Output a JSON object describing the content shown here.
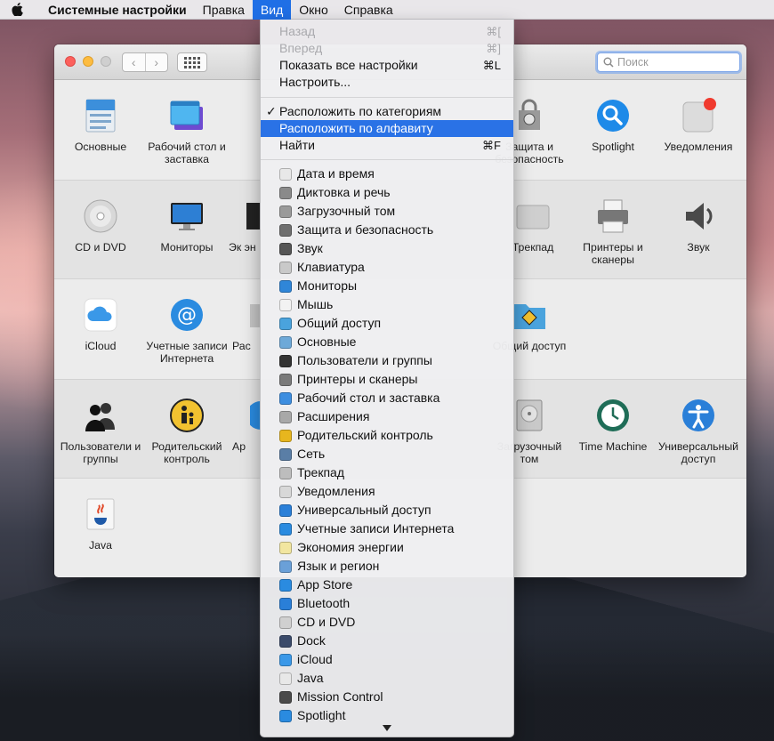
{
  "menubar": {
    "app": "Системные настройки",
    "items": [
      "Правка",
      "Вид",
      "Окно",
      "Справка"
    ]
  },
  "window": {
    "nav_back": "‹",
    "nav_forward": "›",
    "search_placeholder": "Поиск",
    "rows": [
      [
        {
          "label": "Основные",
          "icon": "general-icon"
        },
        {
          "label": "Рабочий стол и заставка",
          "icon": "desktop-icon"
        },
        {
          "label": "Защита и безопасность",
          "icon": "security-icon"
        },
        {
          "label": "Spotlight",
          "icon": "spotlight-icon"
        },
        {
          "label": "Уведомления",
          "icon": "notifications-icon"
        }
      ],
      [
        {
          "label": "CD и DVD",
          "icon": "cd-dvd-icon"
        },
        {
          "label": "Мониторы",
          "icon": "monitor-icon"
        },
        {
          "label": "Эк эн",
          "icon": "energy-icon"
        },
        {
          "label": "Трекпад",
          "icon": "trackpad-icon"
        },
        {
          "label": "Принтеры и сканеры",
          "icon": "printer-icon"
        },
        {
          "label": "Звук",
          "icon": "sound-icon"
        }
      ],
      [
        {
          "label": "iCloud",
          "icon": "icloud-icon"
        },
        {
          "label": "Учетные записи Интернета",
          "icon": "internet-accounts-icon"
        },
        {
          "label": "Рас",
          "icon": "extensions-icon"
        },
        {
          "label": "Общий доступ",
          "icon": "sharing-icon"
        }
      ],
      [
        {
          "label": "Пользователи и группы",
          "icon": "users-icon"
        },
        {
          "label": "Родительский контроль",
          "icon": "parental-icon"
        },
        {
          "label": "Ар",
          "icon": "appstore-icon"
        },
        {
          "label": "Загрузочный том",
          "icon": "startup-disk-icon"
        },
        {
          "label": "Time Machine",
          "icon": "time-machine-icon"
        },
        {
          "label": "Универсальный доступ",
          "icon": "accessibility-icon"
        }
      ],
      [
        {
          "label": "Java",
          "icon": "java-icon"
        }
      ]
    ]
  },
  "view_menu": {
    "top": [
      {
        "label": "Назад",
        "shortcut": "⌘[",
        "disabled": true
      },
      {
        "label": "Вперед",
        "shortcut": "⌘]",
        "disabled": true
      },
      {
        "label": "Показать все настройки",
        "shortcut": "⌘L",
        "disabled": false
      },
      {
        "label": "Настроить...",
        "shortcut": "",
        "disabled": false
      }
    ],
    "arrange": [
      {
        "label": "Расположить по категориям",
        "checked": true
      },
      {
        "label": "Расположить по алфавиту",
        "highlighted": true
      },
      {
        "label": "Найти",
        "shortcut": "⌘F"
      }
    ],
    "prefs": [
      {
        "label": "Дата и время",
        "color": "#e8e8e8"
      },
      {
        "label": "Диктовка и речь",
        "color": "#8a8a8a"
      },
      {
        "label": "Загрузочный том",
        "color": "#9a9a9a"
      },
      {
        "label": "Защита и безопасность",
        "color": "#6f6f6f"
      },
      {
        "label": "Звук",
        "color": "#555555"
      },
      {
        "label": "Клавиатура",
        "color": "#c9c9c9"
      },
      {
        "label": "Мониторы",
        "color": "#2f86d8"
      },
      {
        "label": "Мышь",
        "color": "#f2f2f2"
      },
      {
        "label": "Общий доступ",
        "color": "#4aa3dd"
      },
      {
        "label": "Основные",
        "color": "#6ea9d8"
      },
      {
        "label": "Пользователи и группы",
        "color": "#333333"
      },
      {
        "label": "Принтеры и сканеры",
        "color": "#7a7a7a"
      },
      {
        "label": "Рабочий стол и заставка",
        "color": "#3d8ee0"
      },
      {
        "label": "Расширения",
        "color": "#a8a8a8"
      },
      {
        "label": "Родительский контроль",
        "color": "#e7b61e"
      },
      {
        "label": "Сеть",
        "color": "#5a7ea6"
      },
      {
        "label": "Трекпад",
        "color": "#bdbdbd"
      },
      {
        "label": "Уведомления",
        "color": "#d8d8d8"
      },
      {
        "label": "Универсальный доступ",
        "color": "#2a7fd8"
      },
      {
        "label": "Учетные записи Интернета",
        "color": "#2a8be0"
      },
      {
        "label": "Экономия энергии",
        "color": "#f2e6a0"
      },
      {
        "label": "Язык и регион",
        "color": "#6aa0d8"
      },
      {
        "label": "App Store",
        "color": "#2a8be0"
      },
      {
        "label": "Bluetooth",
        "color": "#2a7fd8"
      },
      {
        "label": "CD и DVD",
        "color": "#d0d0d0"
      },
      {
        "label": "Dock",
        "color": "#3a4a6a"
      },
      {
        "label": "iCloud",
        "color": "#3a98e8"
      },
      {
        "label": "Java",
        "color": "#e8e8e8"
      },
      {
        "label": "Mission Control",
        "color": "#4a4a4a"
      },
      {
        "label": "Spotlight",
        "color": "#2a8be0"
      }
    ]
  }
}
